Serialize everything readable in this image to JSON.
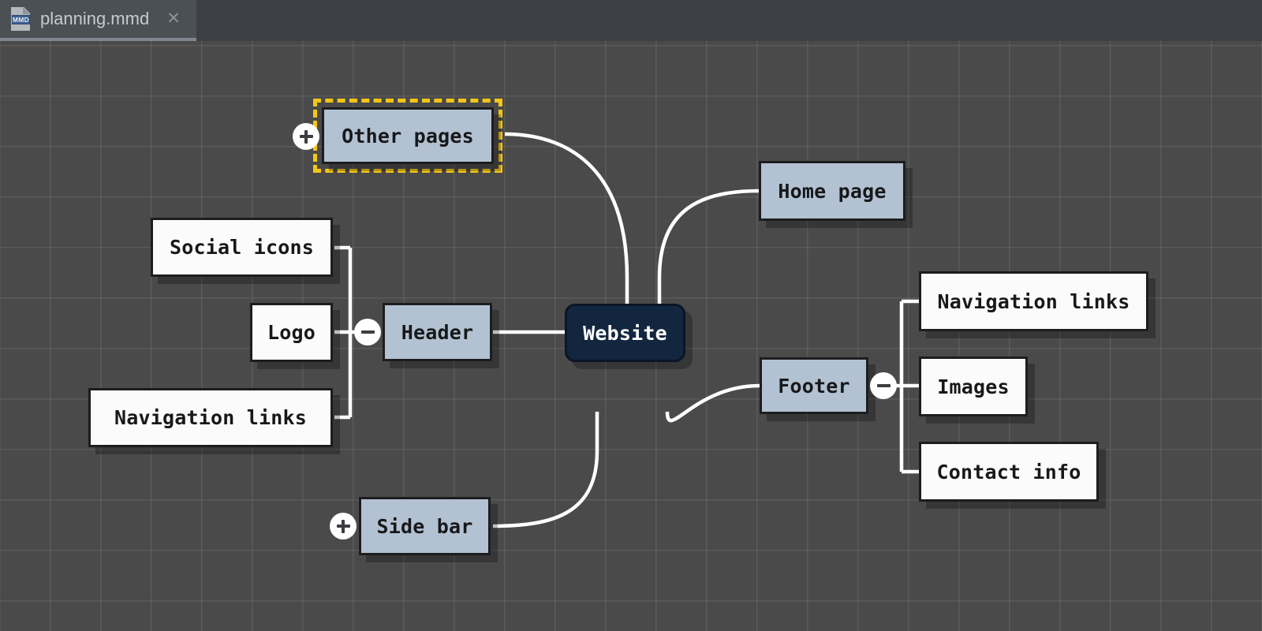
{
  "window": {
    "tab": {
      "title": "planning.mmd",
      "file_icon": "mmd-file-icon",
      "badge_text": "MMD",
      "close_label": "✕"
    }
  },
  "canvas": {
    "grid_size_px": 64,
    "background_color": "#4a4a4a",
    "grid_line_color": "rgba(255,255,255,0.085)"
  },
  "colors": {
    "root_fill": "#12263f",
    "branch_fill": "#b3c2d2",
    "leaf_fill": "#fbfbfb",
    "node_border": "#1c1d1f",
    "selection": "#f5c518",
    "edge": "#ffffff",
    "tab_active_bg": "#4b5055",
    "tab_bar_bg": "#3c4044",
    "tab_underline": "#7e868f"
  },
  "mindmap": {
    "root": {
      "label": "Website"
    },
    "nodes": [
      {
        "id": "other-pages",
        "label": "Other pages",
        "kind": "branch",
        "selected": true,
        "toggle": "plus"
      },
      {
        "id": "home-page",
        "label": "Home page",
        "kind": "branch",
        "selected": false,
        "toggle": "none"
      },
      {
        "id": "header",
        "label": "Header",
        "kind": "branch",
        "selected": false,
        "toggle": "minus"
      },
      {
        "id": "footer",
        "label": "Footer",
        "kind": "branch",
        "selected": false,
        "toggle": "minus"
      },
      {
        "id": "side-bar",
        "label": "Side bar",
        "kind": "branch",
        "selected": false,
        "toggle": "plus"
      },
      {
        "id": "social-icons",
        "label": "Social icons",
        "kind": "leaf",
        "selected": false,
        "toggle": "none"
      },
      {
        "id": "logo",
        "label": "Logo",
        "kind": "leaf",
        "selected": false,
        "toggle": "none"
      },
      {
        "id": "nav-links-left",
        "label": "Navigation links",
        "kind": "leaf",
        "selected": false,
        "toggle": "none"
      },
      {
        "id": "nav-links-right",
        "label": "Navigation links",
        "kind": "leaf",
        "selected": false,
        "toggle": "none"
      },
      {
        "id": "images",
        "label": "Images",
        "kind": "leaf",
        "selected": false,
        "toggle": "none"
      },
      {
        "id": "contact-info",
        "label": "Contact info",
        "kind": "leaf",
        "selected": false,
        "toggle": "none"
      }
    ],
    "toggles": [
      {
        "for": "other-pages",
        "symbol": "+",
        "name": "expand-other-pages-toggle"
      },
      {
        "for": "header",
        "symbol": "−",
        "name": "collapse-header-toggle"
      },
      {
        "for": "footer",
        "symbol": "−",
        "name": "collapse-footer-toggle"
      },
      {
        "for": "side-bar",
        "symbol": "+",
        "name": "expand-side-bar-toggle"
      }
    ]
  }
}
